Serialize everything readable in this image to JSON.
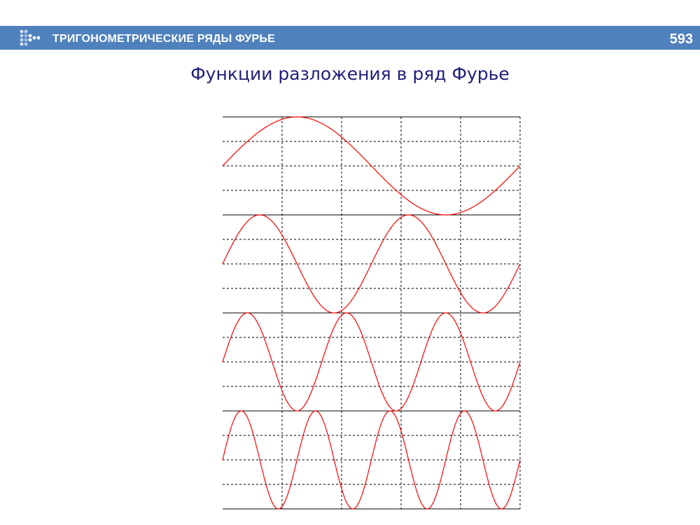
{
  "header": {
    "section_title": "ТРИГОНОМЕТРИЧЕСКИЕ РЯДЫ ФУРЬЕ",
    "page_number": "593",
    "logo_icon": "dots-arrow-icon",
    "bar_color": "#4f81bd"
  },
  "slide": {
    "title": "Функции разложения в ряд Фурье"
  },
  "chart_data": {
    "type": "line",
    "title": "",
    "xlabel": "",
    "ylabel": "",
    "grid": true,
    "line_color": "#ff0000",
    "panels": [
      {
        "function": "sin(x)",
        "harmonic": 1,
        "x_range_periods": [
          0,
          1
        ],
        "ylim": [
          -1,
          1
        ]
      },
      {
        "function": "sin(2x)",
        "harmonic": 2,
        "x_range_periods": [
          0,
          1
        ],
        "ylim": [
          -1,
          1
        ]
      },
      {
        "function": "sin(3x)",
        "harmonic": 3,
        "x_range_periods": [
          0,
          1
        ],
        "ylim": [
          -1,
          1
        ]
      },
      {
        "function": "sin(4x)",
        "harmonic": 4,
        "x_range_periods": [
          0,
          1
        ],
        "ylim": [
          -1,
          1
        ]
      }
    ],
    "vertical_divisions": 5,
    "horizontal_divisions_per_panel": 4
  }
}
